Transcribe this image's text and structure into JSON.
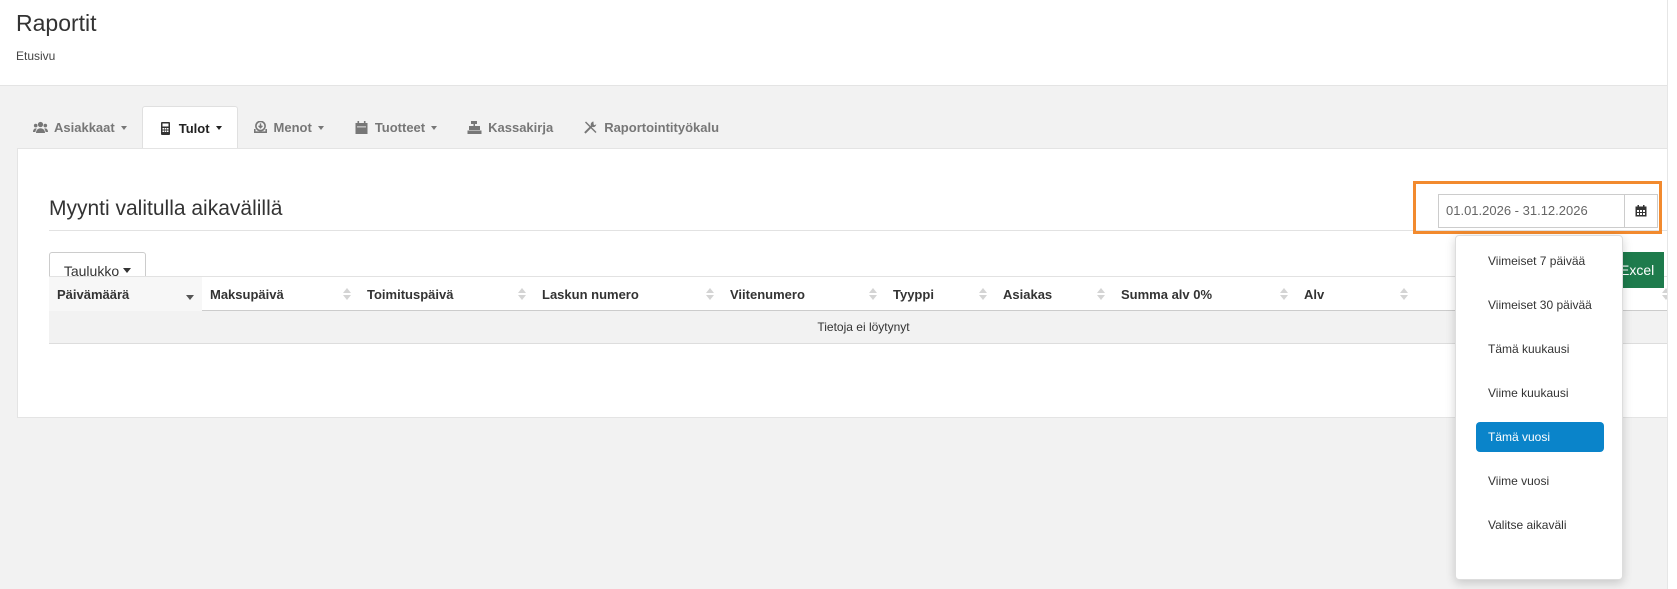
{
  "header": {
    "title": "Raportit",
    "breadcrumb": "Etusivu"
  },
  "tabs": [
    {
      "label": "Asiakkaat",
      "icon": "users-icon",
      "dropdown": true,
      "active": false
    },
    {
      "label": "Tulot",
      "icon": "calculator-icon",
      "dropdown": true,
      "active": true
    },
    {
      "label": "Menot",
      "icon": "download-icon",
      "dropdown": true,
      "active": false
    },
    {
      "label": "Tuotteet",
      "icon": "calendar-icon",
      "dropdown": true,
      "active": false
    },
    {
      "label": "Kassakirja",
      "icon": "cash-register-icon",
      "dropdown": false,
      "active": false
    },
    {
      "label": "Raportointityökalu",
      "icon": "tools-icon",
      "dropdown": false,
      "active": false
    }
  ],
  "section": {
    "title": "Myynti valitulla aikavälillä"
  },
  "date_range": {
    "value": "01.01.2026 - 31.12.2026",
    "button_icon": "calendar-icon",
    "highlight_color": "#f28a2e"
  },
  "view_button": {
    "label": "Taulukko"
  },
  "excel_button": {
    "label": "Excel",
    "color": "#1e7b4c"
  },
  "table": {
    "columns": [
      {
        "label": "Päivämäärä",
        "sort": "desc"
      },
      {
        "label": "Maksupäivä",
        "sort": "none"
      },
      {
        "label": "Toimituspäivä",
        "sort": "none"
      },
      {
        "label": "Laskun numero",
        "sort": "none"
      },
      {
        "label": "Viitenumero",
        "sort": "none"
      },
      {
        "label": "Tyyppi",
        "sort": "none"
      },
      {
        "label": "Asiakas",
        "sort": "none"
      },
      {
        "label": "Summa alv 0%",
        "sort": "none"
      },
      {
        "label": "Alv",
        "sort": "none"
      },
      {
        "label": "",
        "sort": "none"
      }
    ],
    "empty_message": "Tietoja ei löytynyt"
  },
  "date_presets": {
    "items": [
      "Viimeiset 7 päivää",
      "Viimeiset 30 päivää",
      "Tämä kuukausi",
      "Viime kuukausi",
      "Tämä vuosi",
      "Viime vuosi",
      "Valitse aikaväli"
    ],
    "selected": "Tämä vuosi",
    "selected_color": "#0a84ca"
  }
}
